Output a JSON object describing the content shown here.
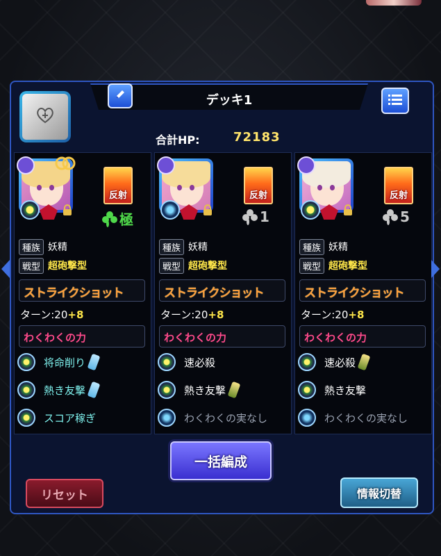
{
  "deck": {
    "title": "デッキ1",
    "hp_label": "合計HP:",
    "hp_value": "72183"
  },
  "members": [
    {
      "reflect_label": "反射",
      "luck_text": "極",
      "luck_color": "#4fd84a",
      "tribe_tag": "種族",
      "tribe": "妖精",
      "type_tag": "戦型",
      "type": "超砲撃型",
      "strike_shot_label": "ストライクショット",
      "turn_label": "ターン:20",
      "turn_bonus": "+8",
      "waku_label": "わくわくの力",
      "abilities": [
        "将命削り",
        "熱き友撃",
        "スコア稼ぎ"
      ],
      "hair_color": "#f4d58a"
    },
    {
      "reflect_label": "反射",
      "luck_text": "1",
      "luck_color": "#c9c9c9",
      "tribe_tag": "種族",
      "tribe": "妖精",
      "type_tag": "戦型",
      "type": "超砲撃型",
      "strike_shot_label": "ストライクショット",
      "turn_label": "ターン:20",
      "turn_bonus": "+8",
      "waku_label": "わくわくの力",
      "abilities": [
        "速必殺",
        "熱き友撃",
        "わくわくの実なし"
      ],
      "hair_color": "#f6dc9a"
    },
    {
      "reflect_label": "反射",
      "luck_text": "5",
      "luck_color": "#c9c9c9",
      "tribe_tag": "種族",
      "tribe": "妖精",
      "type_tag": "戦型",
      "type": "超砲撃型",
      "strike_shot_label": "ストライクショット",
      "turn_label": "ターン:20",
      "turn_bonus": "+8",
      "waku_label": "わくわくの力",
      "abilities": [
        "速必殺",
        "熱き友撃",
        "わくわくの実なし"
      ],
      "hair_color": "#f3ecdf"
    }
  ],
  "buttons": {
    "bulk_edit": "一括編成",
    "reset": "リセット",
    "info_toggle": "情報切替"
  },
  "icons": {
    "edit": "pencil-icon",
    "menu": "list-icon",
    "slot": "heart-plus-icon"
  }
}
